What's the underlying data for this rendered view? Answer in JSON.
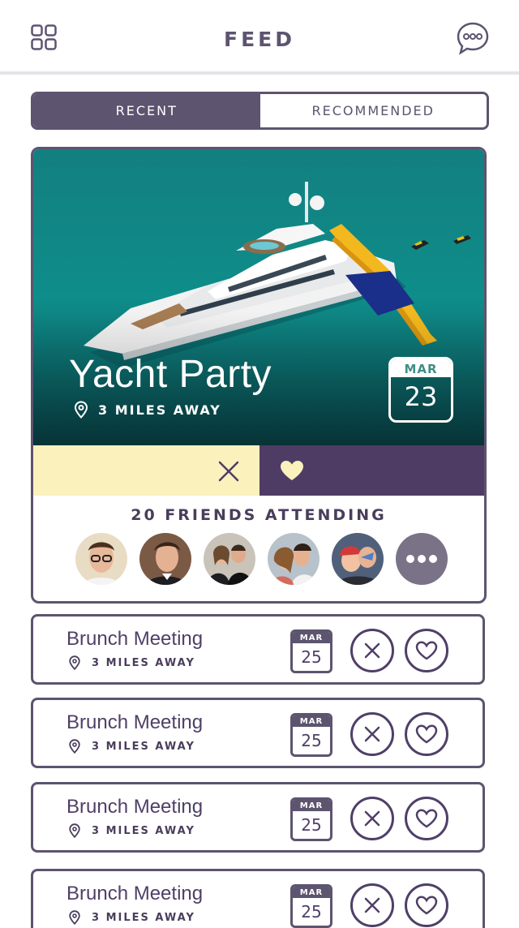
{
  "header": {
    "title": "FEED"
  },
  "tabs": [
    {
      "label": "RECENT"
    },
    {
      "label": "RECOMMENDED"
    }
  ],
  "featured": {
    "title": "Yacht Party",
    "distance": "3 MILES AWAY",
    "month": "MAR",
    "day": "23",
    "friends_attending": "20 FRIENDS ATTENDING"
  },
  "events": [
    {
      "title": "Brunch Meeting",
      "distance": "3 MILES AWAY",
      "month": "MAR",
      "day": "25"
    },
    {
      "title": "Brunch Meeting",
      "distance": "3 MILES AWAY",
      "month": "MAR",
      "day": "25"
    },
    {
      "title": "Brunch Meeting",
      "distance": "3 MILES AWAY",
      "month": "MAR",
      "day": "25"
    },
    {
      "title": "Brunch Meeting",
      "distance": "3 MILES AWAY",
      "month": "MAR",
      "day": "25"
    }
  ],
  "colors": {
    "accent": "#5d5470",
    "dark_purple": "#4f3c64",
    "reject_bg": "#fbf1bd",
    "badge_teal": "#3f8f86"
  }
}
